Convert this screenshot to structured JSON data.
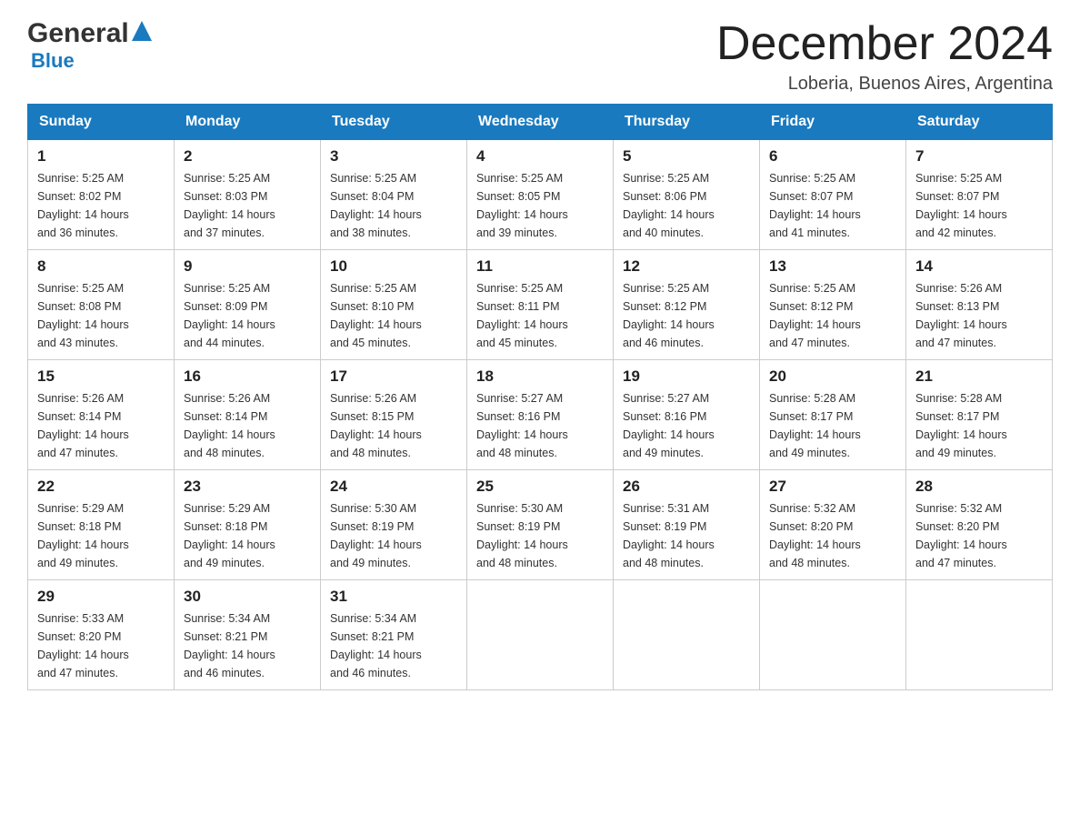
{
  "logo": {
    "general": "General",
    "blue": "Blue"
  },
  "title": {
    "month_year": "December 2024",
    "location": "Loberia, Buenos Aires, Argentina"
  },
  "headers": [
    "Sunday",
    "Monday",
    "Tuesday",
    "Wednesday",
    "Thursday",
    "Friday",
    "Saturday"
  ],
  "weeks": [
    [
      {
        "day": "1",
        "sunrise": "5:25 AM",
        "sunset": "8:02 PM",
        "daylight": "14 hours and 36 minutes."
      },
      {
        "day": "2",
        "sunrise": "5:25 AM",
        "sunset": "8:03 PM",
        "daylight": "14 hours and 37 minutes."
      },
      {
        "day": "3",
        "sunrise": "5:25 AM",
        "sunset": "8:04 PM",
        "daylight": "14 hours and 38 minutes."
      },
      {
        "day": "4",
        "sunrise": "5:25 AM",
        "sunset": "8:05 PM",
        "daylight": "14 hours and 39 minutes."
      },
      {
        "day": "5",
        "sunrise": "5:25 AM",
        "sunset": "8:06 PM",
        "daylight": "14 hours and 40 minutes."
      },
      {
        "day": "6",
        "sunrise": "5:25 AM",
        "sunset": "8:07 PM",
        "daylight": "14 hours and 41 minutes."
      },
      {
        "day": "7",
        "sunrise": "5:25 AM",
        "sunset": "8:07 PM",
        "daylight": "14 hours and 42 minutes."
      }
    ],
    [
      {
        "day": "8",
        "sunrise": "5:25 AM",
        "sunset": "8:08 PM",
        "daylight": "14 hours and 43 minutes."
      },
      {
        "day": "9",
        "sunrise": "5:25 AM",
        "sunset": "8:09 PM",
        "daylight": "14 hours and 44 minutes."
      },
      {
        "day": "10",
        "sunrise": "5:25 AM",
        "sunset": "8:10 PM",
        "daylight": "14 hours and 45 minutes."
      },
      {
        "day": "11",
        "sunrise": "5:25 AM",
        "sunset": "8:11 PM",
        "daylight": "14 hours and 45 minutes."
      },
      {
        "day": "12",
        "sunrise": "5:25 AM",
        "sunset": "8:12 PM",
        "daylight": "14 hours and 46 minutes."
      },
      {
        "day": "13",
        "sunrise": "5:25 AM",
        "sunset": "8:12 PM",
        "daylight": "14 hours and 47 minutes."
      },
      {
        "day": "14",
        "sunrise": "5:26 AM",
        "sunset": "8:13 PM",
        "daylight": "14 hours and 47 minutes."
      }
    ],
    [
      {
        "day": "15",
        "sunrise": "5:26 AM",
        "sunset": "8:14 PM",
        "daylight": "14 hours and 47 minutes."
      },
      {
        "day": "16",
        "sunrise": "5:26 AM",
        "sunset": "8:14 PM",
        "daylight": "14 hours and 48 minutes."
      },
      {
        "day": "17",
        "sunrise": "5:26 AM",
        "sunset": "8:15 PM",
        "daylight": "14 hours and 48 minutes."
      },
      {
        "day": "18",
        "sunrise": "5:27 AM",
        "sunset": "8:16 PM",
        "daylight": "14 hours and 48 minutes."
      },
      {
        "day": "19",
        "sunrise": "5:27 AM",
        "sunset": "8:16 PM",
        "daylight": "14 hours and 49 minutes."
      },
      {
        "day": "20",
        "sunrise": "5:28 AM",
        "sunset": "8:17 PM",
        "daylight": "14 hours and 49 minutes."
      },
      {
        "day": "21",
        "sunrise": "5:28 AM",
        "sunset": "8:17 PM",
        "daylight": "14 hours and 49 minutes."
      }
    ],
    [
      {
        "day": "22",
        "sunrise": "5:29 AM",
        "sunset": "8:18 PM",
        "daylight": "14 hours and 49 minutes."
      },
      {
        "day": "23",
        "sunrise": "5:29 AM",
        "sunset": "8:18 PM",
        "daylight": "14 hours and 49 minutes."
      },
      {
        "day": "24",
        "sunrise": "5:30 AM",
        "sunset": "8:19 PM",
        "daylight": "14 hours and 49 minutes."
      },
      {
        "day": "25",
        "sunrise": "5:30 AM",
        "sunset": "8:19 PM",
        "daylight": "14 hours and 48 minutes."
      },
      {
        "day": "26",
        "sunrise": "5:31 AM",
        "sunset": "8:19 PM",
        "daylight": "14 hours and 48 minutes."
      },
      {
        "day": "27",
        "sunrise": "5:32 AM",
        "sunset": "8:20 PM",
        "daylight": "14 hours and 48 minutes."
      },
      {
        "day": "28",
        "sunrise": "5:32 AM",
        "sunset": "8:20 PM",
        "daylight": "14 hours and 47 minutes."
      }
    ],
    [
      {
        "day": "29",
        "sunrise": "5:33 AM",
        "sunset": "8:20 PM",
        "daylight": "14 hours and 47 minutes."
      },
      {
        "day": "30",
        "sunrise": "5:34 AM",
        "sunset": "8:21 PM",
        "daylight": "14 hours and 46 minutes."
      },
      {
        "day": "31",
        "sunrise": "5:34 AM",
        "sunset": "8:21 PM",
        "daylight": "14 hours and 46 minutes."
      },
      null,
      null,
      null,
      null
    ]
  ],
  "labels": {
    "sunrise": "Sunrise:",
    "sunset": "Sunset:",
    "daylight": "Daylight:"
  }
}
